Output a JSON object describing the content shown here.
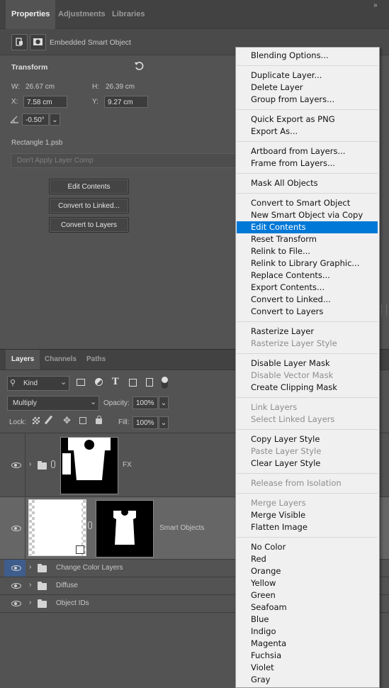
{
  "properties": {
    "tabs": [
      "Properties",
      "Adjustments",
      "Libraries"
    ],
    "object_type": "Embedded Smart Object",
    "transform_title": "Transform",
    "w_label": "W:",
    "w_value": "26.67 cm",
    "h_label": "H:",
    "h_value": "26.39 cm",
    "x_label": "X:",
    "x_value": "7.58 cm",
    "y_label": "Y:",
    "y_value": "9.27 cm",
    "angle_value": "-0.50°",
    "file_name": "Rectangle 1.psb",
    "layer_comp_placeholder": "Don't Apply Layer Comp",
    "buttons": [
      "Edit Contents",
      "Convert to Linked...",
      "Convert to Layers"
    ]
  },
  "layers_panel": {
    "tabs": [
      "Layers",
      "Channels",
      "Paths"
    ],
    "filter_kind": "Kind",
    "blend_mode": "Multiply",
    "opacity_label": "Opacity:",
    "opacity_value": "100%",
    "lock_label": "Lock:",
    "fill_label": "Fill:",
    "fill_value": "100%",
    "layers": [
      {
        "name": "FX"
      },
      {
        "name": "Smart Objects"
      },
      {
        "name": "Change Color Layers"
      },
      {
        "name": "Diffuse"
      },
      {
        "name": "Object IDs"
      }
    ]
  },
  "context_menu": {
    "groups": [
      [
        {
          "label": "Blending Options..."
        }
      ],
      [
        {
          "label": "Duplicate Layer..."
        },
        {
          "label": "Delete Layer"
        },
        {
          "label": "Group from Layers..."
        }
      ],
      [
        {
          "label": "Quick Export as PNG"
        },
        {
          "label": "Export As..."
        }
      ],
      [
        {
          "label": "Artboard from Layers..."
        },
        {
          "label": "Frame from Layers..."
        }
      ],
      [
        {
          "label": "Mask All Objects"
        }
      ],
      [
        {
          "label": "Convert to Smart Object"
        },
        {
          "label": "New Smart Object via Copy"
        },
        {
          "label": "Edit Contents",
          "highlighted": true
        },
        {
          "label": "Reset Transform"
        },
        {
          "label": "Relink to File..."
        },
        {
          "label": "Relink to Library Graphic..."
        },
        {
          "label": "Replace Contents..."
        },
        {
          "label": "Export Contents..."
        },
        {
          "label": "Convert to Linked..."
        },
        {
          "label": "Convert to Layers"
        }
      ],
      [
        {
          "label": "Rasterize Layer"
        },
        {
          "label": "Rasterize Layer Style",
          "disabled": true
        }
      ],
      [
        {
          "label": "Disable Layer Mask"
        },
        {
          "label": "Disable Vector Mask",
          "disabled": true
        },
        {
          "label": "Create Clipping Mask"
        }
      ],
      [
        {
          "label": "Link Layers",
          "disabled": true
        },
        {
          "label": "Select Linked Layers",
          "disabled": true
        }
      ],
      [
        {
          "label": "Copy Layer Style"
        },
        {
          "label": "Paste Layer Style",
          "disabled": true
        },
        {
          "label": "Clear Layer Style"
        }
      ],
      [
        {
          "label": "Release from Isolation",
          "disabled": true
        }
      ],
      [
        {
          "label": "Merge Layers",
          "disabled": true
        },
        {
          "label": "Merge Visible"
        },
        {
          "label": "Flatten Image"
        }
      ],
      [
        {
          "label": "No Color"
        },
        {
          "label": "Red"
        },
        {
          "label": "Orange"
        },
        {
          "label": "Yellow"
        },
        {
          "label": "Green"
        },
        {
          "label": "Seafoam"
        },
        {
          "label": "Blue"
        },
        {
          "label": "Indigo"
        },
        {
          "label": "Magenta"
        },
        {
          "label": "Fuchsia"
        },
        {
          "label": "Violet"
        },
        {
          "label": "Gray"
        }
      ]
    ]
  },
  "colors": {
    "highlight": "#0078d7",
    "panel": "#535353",
    "selected_row": "#666666"
  }
}
